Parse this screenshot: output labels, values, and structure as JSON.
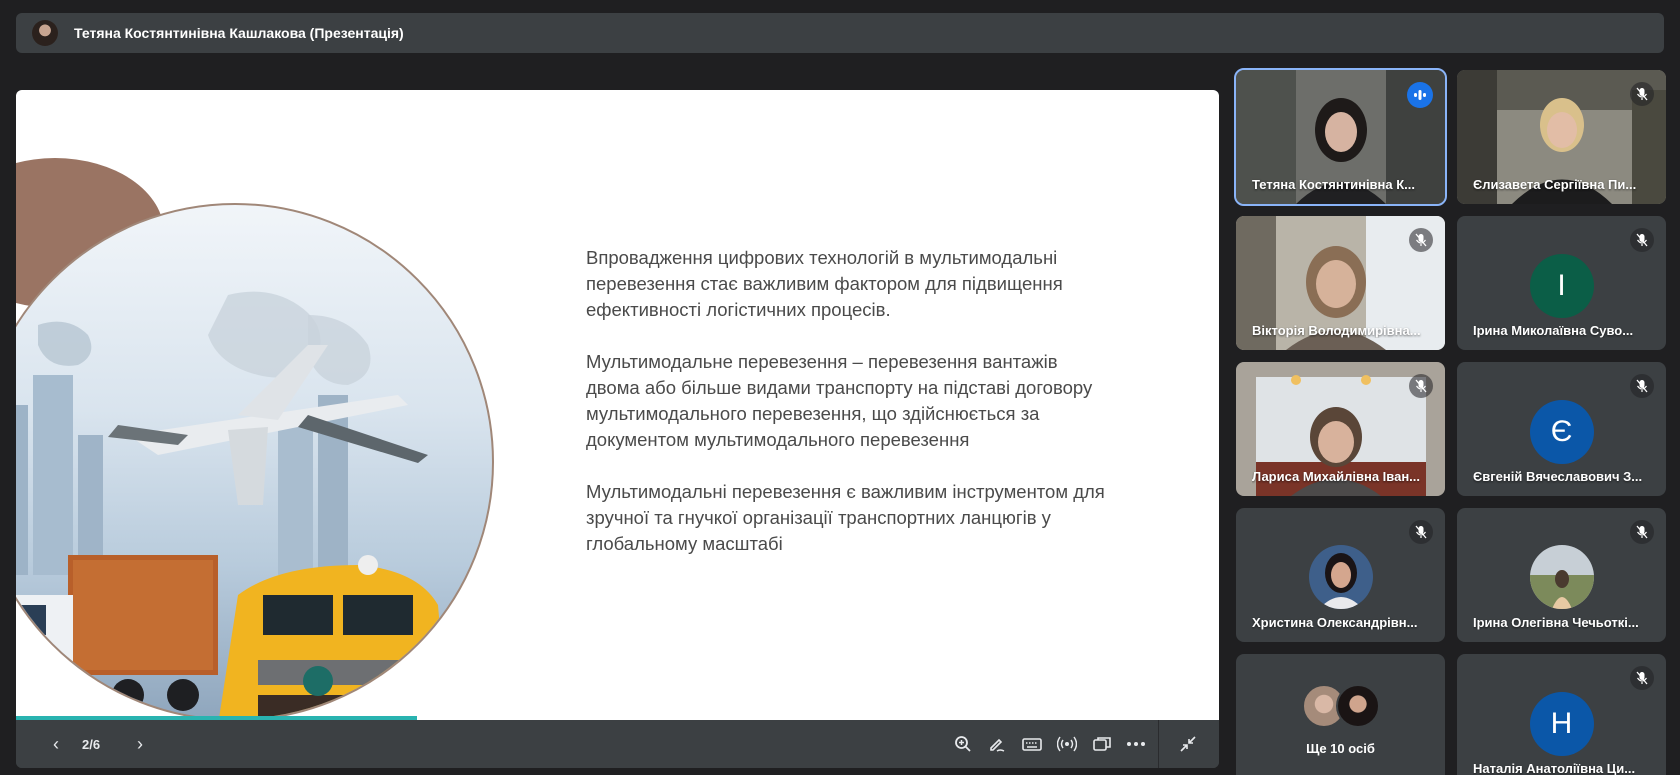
{
  "topbar": {
    "title": "Тетяна Костянтинівна Кашлакова (Презентація)"
  },
  "slide": {
    "paragraphs": [
      "Впровадження цифрових технологій в мультимодальні перевезення стає важливим фактором для підвищення ефективності логістичних процесів.",
      "Мультимодальне перевезення – перевезення вантажів двома або більше видами транспорту на підставі договору мультимодального перевезення, що здійснюється за документом мультимодального перевезення",
      "Мультимодальні перевезення є важливим інструментом для зручної та гнучкої організації транспортних ланцюгів у глобальному масштабі"
    ],
    "page_label": "2/6",
    "progress_fraction": 0.333
  },
  "controls": {
    "prev_icon": "chevron-left-icon",
    "next_icon": "chevron-right-icon",
    "prev_glyph": "‹",
    "next_glyph": "›",
    "tools": [
      "zoom-in-icon",
      "annotate-pen-icon",
      "keyboard-icon",
      "broadcast-icon",
      "switch-view-icon",
      "more-options-icon"
    ],
    "exit_icon": "minimize-icon"
  },
  "participants": [
    {
      "name": "Тетяна Костянтинівна К...",
      "type": "video",
      "status": "speaking"
    },
    {
      "name": "Єлизавета Сергіївна Пи...",
      "type": "video",
      "status": "muted"
    },
    {
      "name": "Вікторія Володимирівна...",
      "type": "video",
      "status": "muted"
    },
    {
      "name": "Ірина Миколаївна Суво...",
      "type": "letter",
      "letter": "І",
      "color": "#0b5e47",
      "status": "muted"
    },
    {
      "name": "Лариса Михайлівна Іван...",
      "type": "video",
      "status": "muted"
    },
    {
      "name": "Євгеній Вячеславович З...",
      "type": "letter",
      "letter": "Є",
      "color": "#0b57a8",
      "status": "muted"
    },
    {
      "name": "Христина Олександрівн...",
      "type": "photo",
      "status": "muted"
    },
    {
      "name": "Ірина Олегівна Чечьоткі...",
      "type": "photo",
      "status": "muted"
    },
    {
      "name": "Наталія Анатоліївна Ци...",
      "type": "letter",
      "letter": "Н",
      "color": "#0b57a8",
      "status": "muted"
    }
  ],
  "more": {
    "label": "Ще 10 осіб"
  },
  "colors": {
    "accent": "#8ab4f8",
    "progress": "#29b3b0",
    "tile_bg": "#3c4043"
  }
}
